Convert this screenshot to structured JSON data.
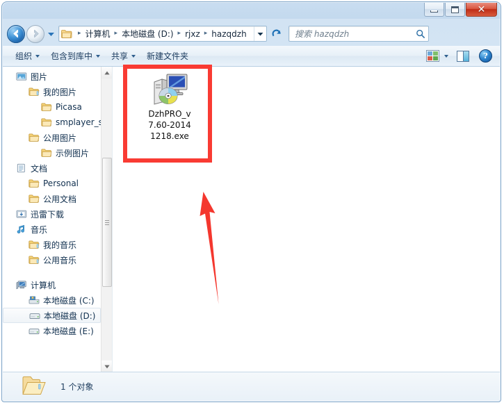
{
  "window": {
    "buttons": {
      "minimize": "minimize",
      "maximize": "maximize",
      "close": "✕"
    }
  },
  "addressbar": {
    "breadcrumbs": [
      "计算机",
      "本地磁盘 (D:)",
      "rjxz",
      "hazqdzh"
    ],
    "separator": "▸",
    "dropdown_label": "▾",
    "refresh_label": "refresh"
  },
  "search": {
    "placeholder": "搜索 hazqdzh"
  },
  "toolbar": {
    "items": [
      {
        "label": "组织",
        "has_caret": true
      },
      {
        "label": "包含到库中",
        "has_caret": true
      },
      {
        "label": "共享",
        "has_caret": true
      },
      {
        "label": "新建文件夹",
        "has_caret": false
      }
    ],
    "view_caret": "▾",
    "help_label": "?"
  },
  "sidebar": {
    "items": [
      {
        "label": "图片",
        "indent": 1,
        "icon": "picture-library-icon",
        "selected": false
      },
      {
        "label": "我的图片",
        "indent": 2,
        "icon": "my-pictures-folder-icon",
        "selected": false
      },
      {
        "label": "Picasa",
        "indent": 3,
        "icon": "folder-icon",
        "selected": false
      },
      {
        "label": "smplayer_sc",
        "indent": 3,
        "icon": "folder-icon",
        "selected": false
      },
      {
        "label": "公用图片",
        "indent": 2,
        "icon": "folder-icon",
        "selected": false
      },
      {
        "label": "示例图片",
        "indent": 3,
        "icon": "folder-icon",
        "selected": false
      },
      {
        "label": "文档",
        "indent": 1,
        "icon": "document-library-icon",
        "selected": false
      },
      {
        "label": "Personal",
        "indent": 2,
        "icon": "folder-icon",
        "selected": false
      },
      {
        "label": "公用文档",
        "indent": 2,
        "icon": "folder-icon",
        "selected": false
      },
      {
        "label": "迅雷下载",
        "indent": 1,
        "icon": "download-library-icon",
        "selected": false
      },
      {
        "label": "音乐",
        "indent": 1,
        "icon": "music-library-icon",
        "selected": false
      },
      {
        "label": "我的音乐",
        "indent": 2,
        "icon": "music-folder-icon",
        "selected": false
      },
      {
        "label": "公用音乐",
        "indent": 2,
        "icon": "music-folder-icon",
        "selected": false
      },
      {
        "label": "计算机",
        "indent": 1,
        "icon": "computer-icon",
        "selected": false,
        "gap_before": true
      },
      {
        "label": "本地磁盘 (C:)",
        "indent": 2,
        "icon": "system-drive-icon",
        "selected": false
      },
      {
        "label": "本地磁盘 (D:)",
        "indent": 2,
        "icon": "drive-icon",
        "selected": true
      },
      {
        "label": "本地磁盘 (E:)",
        "indent": 2,
        "icon": "drive-icon",
        "selected": false
      }
    ]
  },
  "files": [
    {
      "name": "DzhPRO_v7.60-20141218.exe",
      "name_lines": [
        "DzhPRO_v",
        "7.60-2014",
        "1218.exe"
      ],
      "icon": "setup-exe-icon"
    }
  ],
  "statusbar": {
    "icon": "open-folder-icon",
    "text": "1 个对象"
  },
  "annotations": {
    "highlight_color": "#f93b33",
    "rectangle": "highlight-rectangle",
    "arrow": "pointer-arrow"
  }
}
